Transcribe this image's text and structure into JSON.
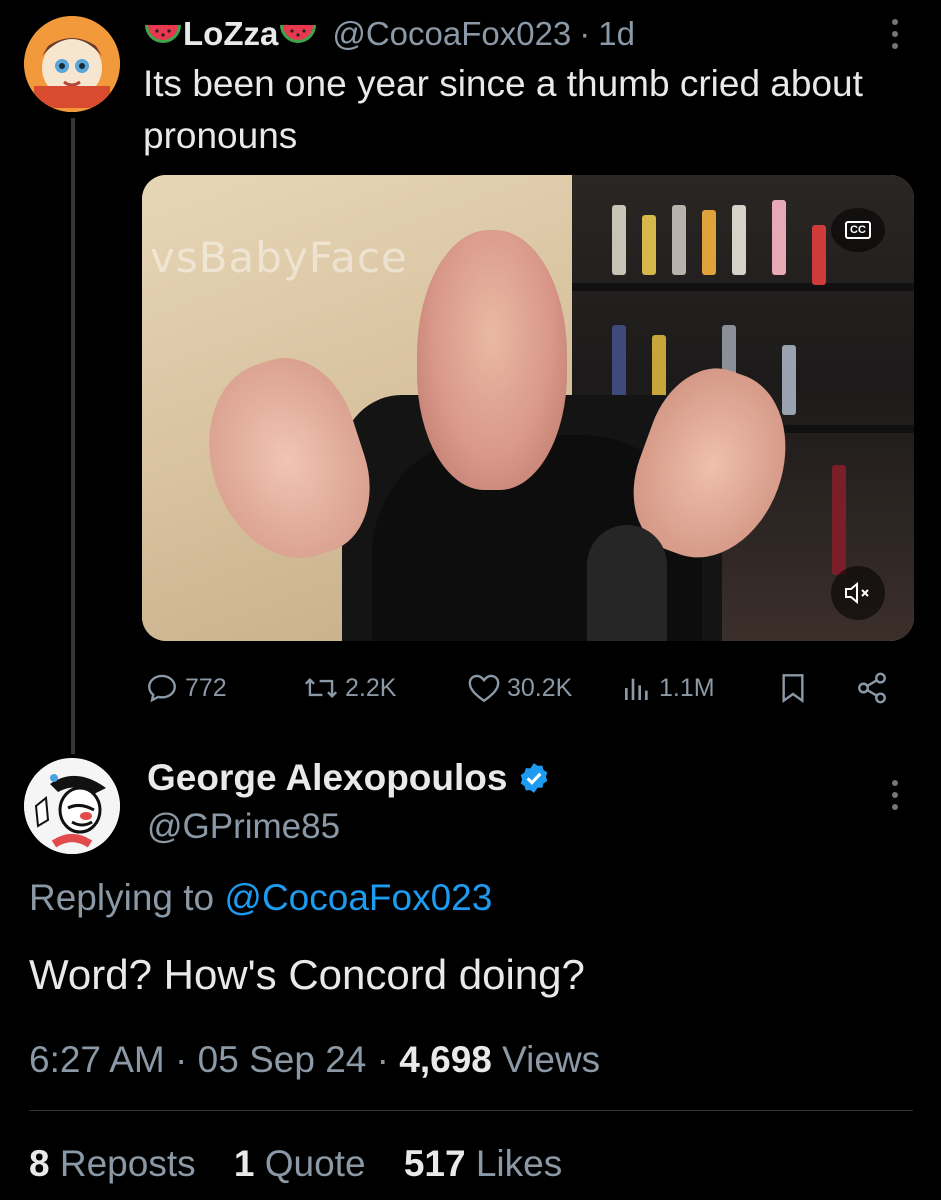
{
  "parent_tweet": {
    "display_name": "LoZza",
    "handle": "@CocoaFox023",
    "separator": "·",
    "time_ago": "1d",
    "text": "Its been one year since a thumb cried about pronouns",
    "media_watermark": "vsBabyFace",
    "media_caption_button": "CC",
    "stats": {
      "replies": "772",
      "reposts": "2.2K",
      "likes": "30.2K",
      "views": "1.1M"
    }
  },
  "reply_tweet": {
    "display_name": "George Alexopoulos",
    "handle": "@GPrime85",
    "verified": true,
    "replying_prefix": "Replying to",
    "replying_to": "@CocoaFox023",
    "text": "Word? How's Concord doing?",
    "time": "6:27 AM",
    "date": "05 Sep 24",
    "separator": "·",
    "views_count": "4,698",
    "views_label": "Views",
    "engagement": {
      "reposts_count": "8",
      "reposts_label": "Reposts",
      "quotes_count": "1",
      "quotes_label": "Quote",
      "likes_count": "517",
      "likes_label": "Likes"
    }
  },
  "colors": {
    "background": "#000000",
    "text_primary": "#e7e9ea",
    "text_secondary": "#8b98a5",
    "accent": "#1d9bf0",
    "divider": "#2f3336"
  },
  "icons": [
    "watermelon-emoji",
    "more-icon",
    "captions-icon",
    "mute-icon",
    "reply-icon",
    "repost-icon",
    "like-icon",
    "views-icon",
    "bookmark-icon",
    "share-icon",
    "verified-badge-icon"
  ]
}
